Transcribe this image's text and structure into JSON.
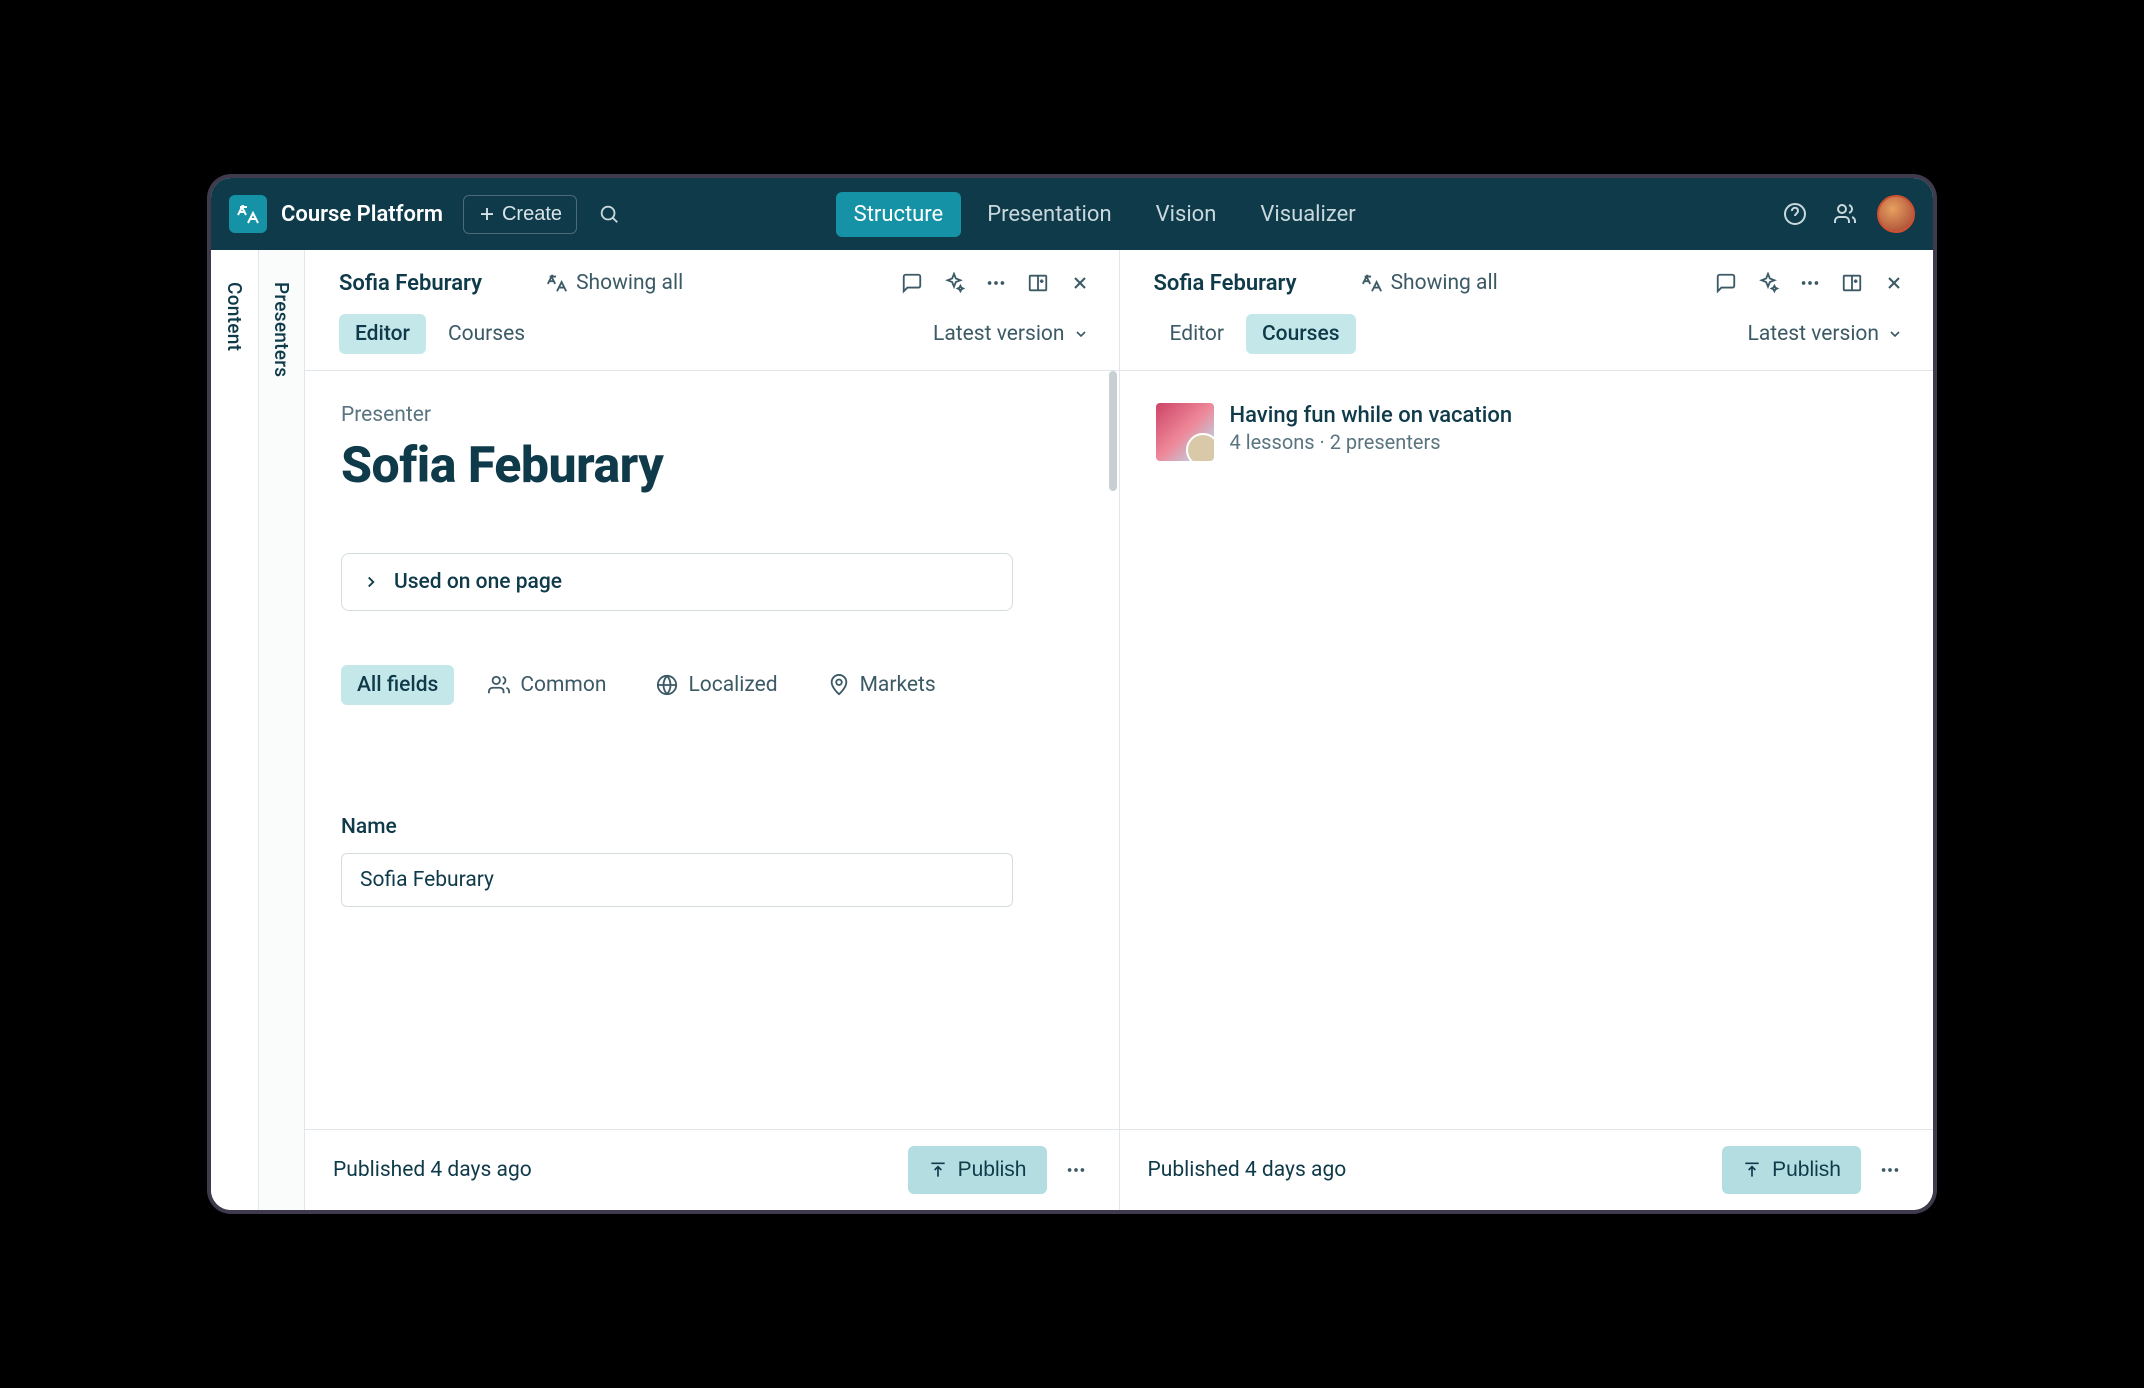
{
  "header": {
    "platform_name": "Course Platform",
    "create_label": "Create",
    "nav_tabs": [
      "Structure",
      "Presentation",
      "Vision",
      "Visualizer"
    ],
    "active_nav_tab": "Structure"
  },
  "rails": {
    "content": "Content",
    "presenters": "Presenters"
  },
  "panel_left": {
    "title": "Sofia Feburary",
    "showing_label": "Showing all",
    "subtabs": {
      "editor": "Editor",
      "courses": "Courses"
    },
    "active_subtab": "Editor",
    "version_label": "Latest version",
    "editor": {
      "type_label": "Presenter",
      "heading": "Sofia Feburary",
      "used_on_label": "Used on one page",
      "filters": {
        "all_fields": "All fields",
        "common": "Common",
        "localized": "Localized",
        "markets": "Markets"
      },
      "name_field": {
        "label": "Name",
        "value": "Sofia Feburary"
      }
    },
    "footer": {
      "status": "Published 4 days ago",
      "publish_label": "Publish"
    }
  },
  "panel_right": {
    "title": "Sofia Feburary",
    "showing_label": "Showing all",
    "subtabs": {
      "editor": "Editor",
      "courses": "Courses"
    },
    "active_subtab": "Courses",
    "version_label": "Latest version",
    "courses": [
      {
        "title": "Having fun while on vacation",
        "subtitle": "4 lessons · 2 presenters"
      }
    ],
    "footer": {
      "status": "Published 4 days ago",
      "publish_label": "Publish"
    }
  }
}
